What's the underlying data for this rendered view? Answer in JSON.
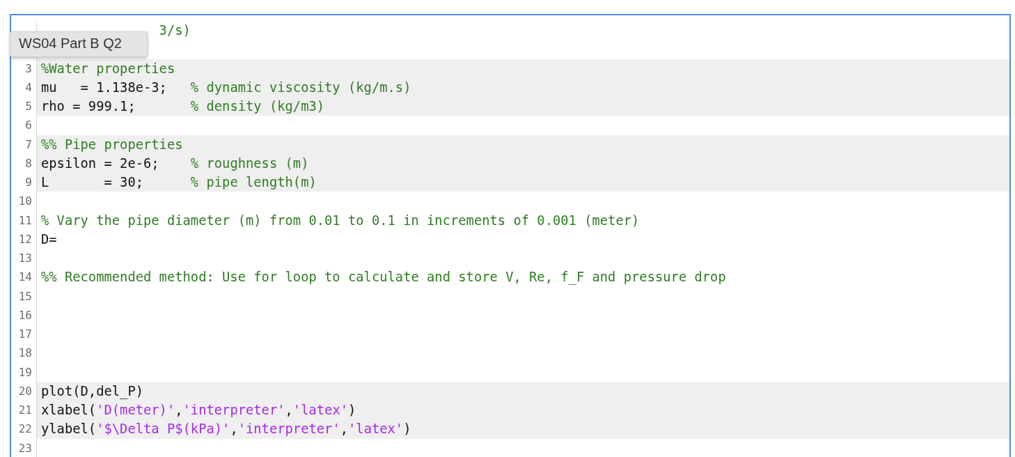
{
  "tooltip": {
    "text": "WS04 Part B Q2"
  },
  "lines": [
    {
      "kind": "covered",
      "shaded": false,
      "segments": [
        {
          "kind": "comment",
          "text": "               3/s)"
        }
      ]
    },
    {
      "kind": "hidden"
    },
    {
      "kind": "line",
      "number": "3",
      "shaded": true,
      "segments": [
        {
          "kind": "comment",
          "text": "%Water properties"
        }
      ]
    },
    {
      "kind": "line",
      "number": "4",
      "shaded": true,
      "segments": [
        {
          "kind": "code",
          "text": "mu   = 1.138e-3;   "
        },
        {
          "kind": "comment",
          "text": "% dynamic viscosity (kg/m.s)"
        }
      ]
    },
    {
      "kind": "line",
      "number": "5",
      "shaded": true,
      "segments": [
        {
          "kind": "code",
          "text": "rho = 999.1;       "
        },
        {
          "kind": "comment",
          "text": "% density (kg/m3)"
        }
      ]
    },
    {
      "kind": "line",
      "number": "6",
      "shaded": false
    },
    {
      "kind": "line",
      "number": "7",
      "shaded": true,
      "segments": [
        {
          "kind": "comment",
          "text": "%% Pipe properties"
        }
      ]
    },
    {
      "kind": "line",
      "number": "8",
      "shaded": true,
      "segments": [
        {
          "kind": "code",
          "text": "epsilon = 2e-6;    "
        },
        {
          "kind": "comment",
          "text": "% roughness (m)"
        }
      ]
    },
    {
      "kind": "line",
      "number": "9",
      "shaded": true,
      "segments": [
        {
          "kind": "code",
          "text": "L       = 30;      "
        },
        {
          "kind": "comment",
          "text": "% pipe length(m)"
        }
      ]
    },
    {
      "kind": "line",
      "number": "10",
      "shaded": false
    },
    {
      "kind": "line",
      "number": "11",
      "shaded": false,
      "segments": [
        {
          "kind": "comment",
          "text": "% Vary the pipe diameter (m) from 0.01 to 0.1 in increments of 0.001 (meter)"
        }
      ]
    },
    {
      "kind": "line",
      "number": "12",
      "shaded": false,
      "segments": [
        {
          "kind": "code",
          "text": "D="
        }
      ]
    },
    {
      "kind": "line",
      "number": "13",
      "shaded": false
    },
    {
      "kind": "line",
      "number": "14",
      "shaded": false,
      "segments": [
        {
          "kind": "comment",
          "text": "%% Recommended method: Use for loop to calculate and store V, Re, f_F and pressure drop"
        }
      ]
    },
    {
      "kind": "line",
      "number": "15",
      "shaded": false
    },
    {
      "kind": "line",
      "number": "16",
      "shaded": false
    },
    {
      "kind": "line",
      "number": "17",
      "shaded": false
    },
    {
      "kind": "line",
      "number": "18",
      "shaded": false
    },
    {
      "kind": "line",
      "number": "19",
      "shaded": false
    },
    {
      "kind": "line",
      "number": "20",
      "shaded": true,
      "segments": [
        {
          "kind": "code",
          "text": "plot(D,del_P)"
        }
      ]
    },
    {
      "kind": "line",
      "number": "21",
      "shaded": true,
      "segments": [
        {
          "kind": "code",
          "text": "xlabel("
        },
        {
          "kind": "string",
          "text": "'D(meter)'"
        },
        {
          "kind": "code",
          "text": ","
        },
        {
          "kind": "string",
          "text": "'interpreter'"
        },
        {
          "kind": "code",
          "text": ","
        },
        {
          "kind": "string",
          "text": "'latex'"
        },
        {
          "kind": "code",
          "text": ")"
        }
      ]
    },
    {
      "kind": "line",
      "number": "22",
      "shaded": true,
      "segments": [
        {
          "kind": "code",
          "text": "ylabel("
        },
        {
          "kind": "string",
          "text": "'$\\Delta P$(kPa)'"
        },
        {
          "kind": "code",
          "text": ","
        },
        {
          "kind": "string",
          "text": "'interpreter'"
        },
        {
          "kind": "code",
          "text": ","
        },
        {
          "kind": "string",
          "text": "'latex'"
        },
        {
          "kind": "code",
          "text": ")"
        }
      ]
    },
    {
      "kind": "line",
      "number": "23",
      "shaded": false
    }
  ]
}
